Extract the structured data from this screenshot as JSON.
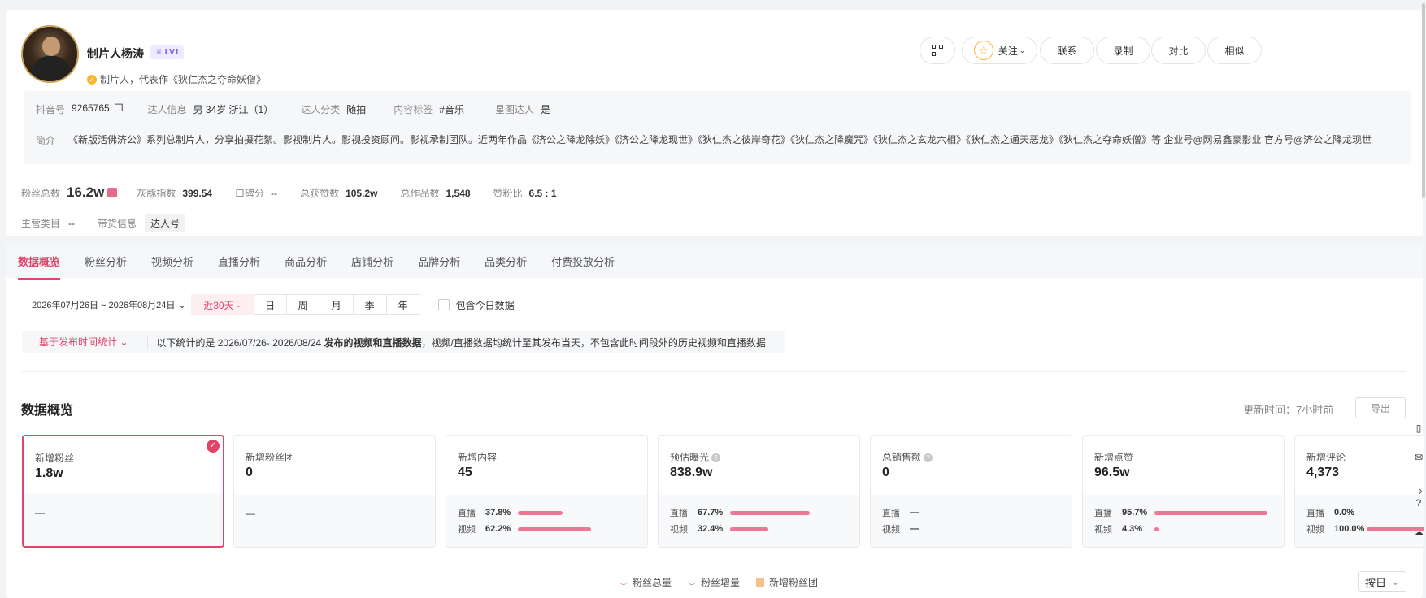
{
  "profile": {
    "name": "制片人杨涛",
    "level": "LV1",
    "verified_text": "制片人，代表作《狄仁杰之夺命妖僧》"
  },
  "actions": {
    "follow": "关注",
    "contact": "联系",
    "record": "录制",
    "compare": "对比",
    "similar": "相似"
  },
  "info": {
    "douyin_label": "抖音号",
    "douyin_value": "9265765",
    "talent_label": "达人信息",
    "talent_value": "男 34岁 浙江（1）",
    "category_label": "达人分类",
    "category_value": "随拍",
    "content_label": "内容标签",
    "content_value": "#音乐",
    "star_label": "星图达人",
    "star_value": "是",
    "bio_label": "简介",
    "bio_text": "《新版活佛济公》系列总制片人，分享拍摄花絮。影视制片人。影视投资顾问。影视承制团队。近两年作品《济公之降龙除妖》《济公之降龙现世》《狄仁杰之彼岸奇花》《狄仁杰之降魔咒》《狄仁杰之玄龙六相》《狄仁杰之通天恶龙》《狄仁杰之夺命妖僧》等 企业号@网易鑫豪影业 官方号@济公之降龙现世"
  },
  "stats": {
    "fans_label": "粉丝总数",
    "fans_value": "16.2w",
    "index_label": "灰豚指数",
    "index_value": "399.54",
    "rep_label": "口碑分",
    "rep_value": "--",
    "likes_label": "总获赞数",
    "likes_value": "105.2w",
    "works_label": "总作品数",
    "works_value": "1,548",
    "ratio_label": "赞粉比",
    "ratio_value": "6.5 : 1",
    "main_cat_label": "主营类目",
    "main_cat_value": "--",
    "goods_label": "带货信息",
    "goods_value": "达人号"
  },
  "tabs": [
    "数据概览",
    "粉丝分析",
    "视频分析",
    "直播分析",
    "商品分析",
    "店铺分析",
    "品牌分析",
    "品类分析",
    "付费投放分析"
  ],
  "filter": {
    "date_range": "2026年07月26日 ~ 2026年08月24日",
    "period_active": "近30天",
    "periods": [
      "日",
      "周",
      "月",
      "季",
      "年"
    ],
    "include_today": "包含今日数据"
  },
  "note": {
    "selector": "基于发布时间统计",
    "prefix": "以下统计的是 2026/07/26- 2026/08/24 ",
    "bold": "发布的视频和直播数据",
    "suffix": "，视频/直播数据均统计至其发布当天，不包含此时间段外的历史视频和直播数据"
  },
  "overview": {
    "title": "数据概览",
    "update": "更新时间：7小时前",
    "export": "导出"
  },
  "metrics": [
    {
      "label": "新增粉丝",
      "value": "1.8w",
      "dash": "—"
    },
    {
      "label": "新增粉丝团",
      "value": "0",
      "dash": "—"
    },
    {
      "label": "新增内容",
      "value": "45",
      "live_label": "直播",
      "live_pct": "37.8%",
      "live_fill": 0.378,
      "video_label": "视频",
      "video_pct": "62.2%",
      "video_fill": 0.622
    },
    {
      "label": "预估曝光",
      "value": "838.9w",
      "live_label": "直播",
      "live_pct": "67.7%",
      "live_fill": 0.677,
      "video_label": "视频",
      "video_pct": "32.4%",
      "video_fill": 0.324
    },
    {
      "label": "总销售额",
      "value": "0",
      "live_label": "直播",
      "live_pct": "—",
      "video_label": "视频",
      "video_pct": "—"
    },
    {
      "label": "新增点赞",
      "value": "96.5w",
      "live_label": "直播",
      "live_pct": "95.7%",
      "live_fill": 0.957,
      "video_label": "视频",
      "video_pct": "4.3%",
      "video_fill": 0.043
    },
    {
      "label": "新增评论",
      "value": "4,373",
      "live_label": "直播",
      "live_pct": "0.0%",
      "live_fill": 0.0,
      "video_label": "视频",
      "video_pct": "100.0%",
      "video_fill": 1.0
    }
  ],
  "legend": [
    "粉丝总量",
    "粉丝增量",
    "新增粉丝团"
  ],
  "granularity": "按日",
  "colors": {
    "accent": "#e1446b",
    "bar": "#ee7796",
    "gold": "#f5b82e"
  }
}
